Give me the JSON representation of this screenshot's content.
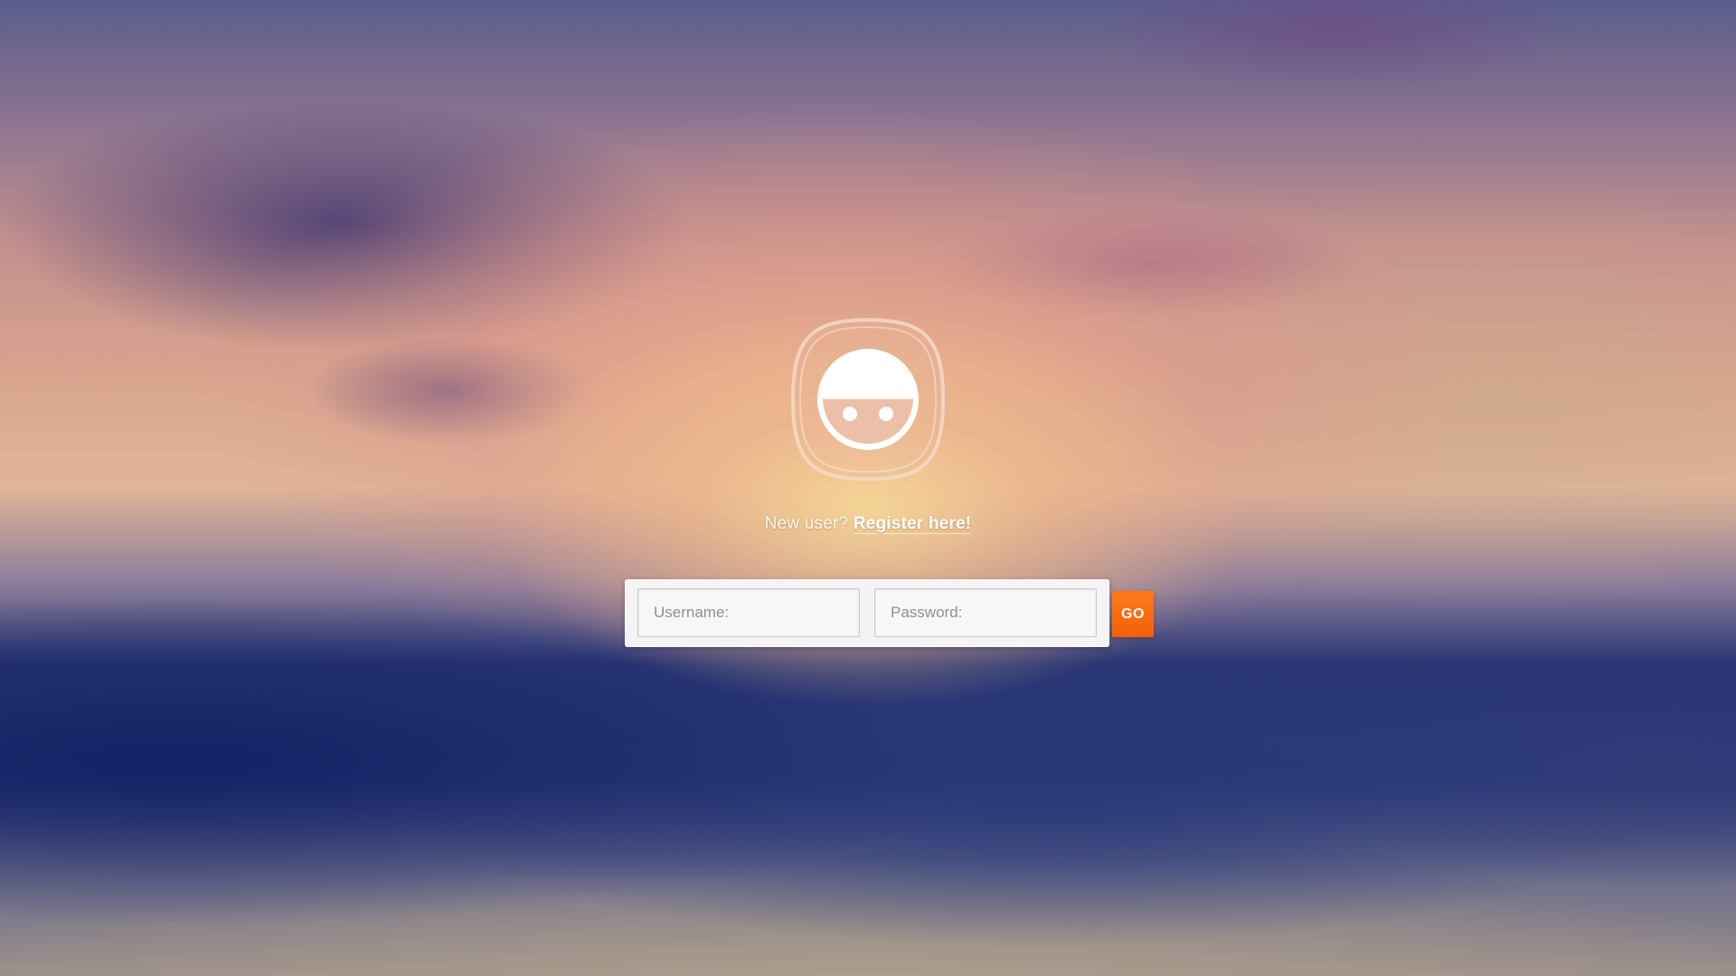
{
  "register": {
    "prompt": "New user?",
    "link_label": "Register here!"
  },
  "login_form": {
    "username_placeholder": "Username:",
    "password_placeholder": "Password:",
    "submit_label": "GO"
  },
  "colors": {
    "accent": "#f26a10",
    "form_background": "#f4f4f5"
  },
  "logo": {
    "icon": "smiley-face-icon"
  }
}
